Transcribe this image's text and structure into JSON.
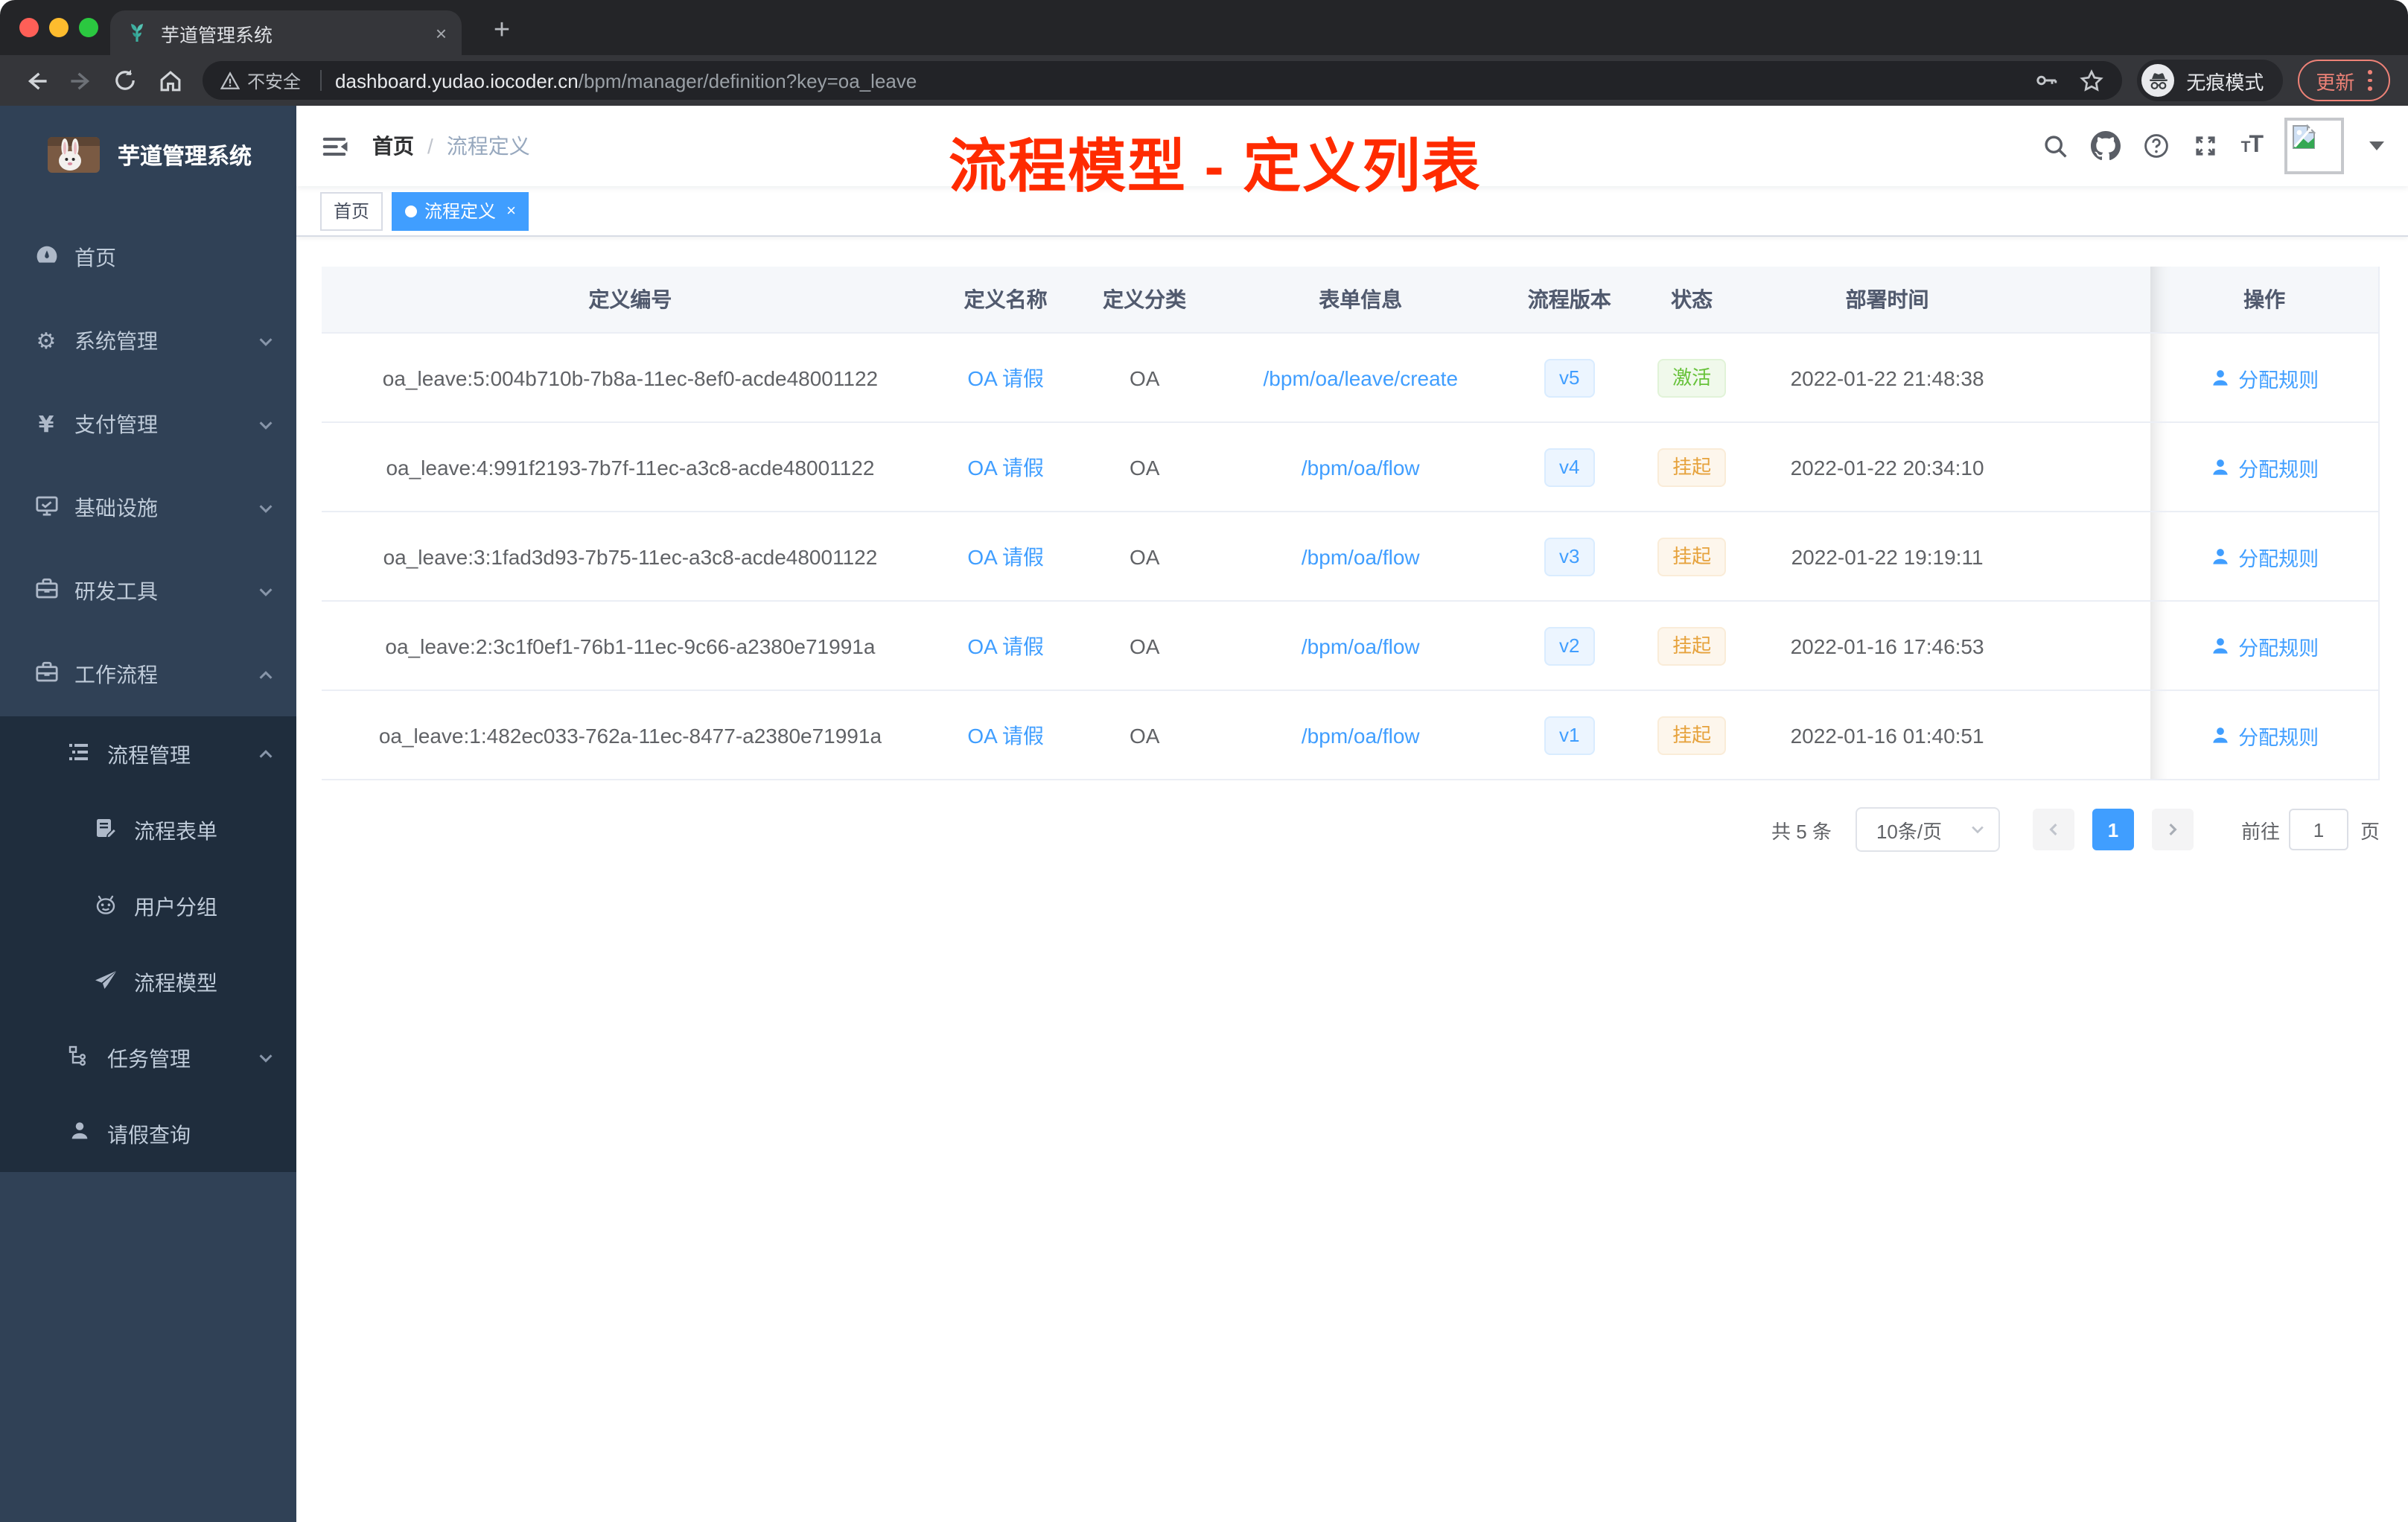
{
  "browser": {
    "tab_title": "芋道管理系统",
    "tab_close": "×",
    "new_tab": "+",
    "address": {
      "security_label": "不安全",
      "domain": "dashboard.yudao.iocoder.cn",
      "path": "/bpm/manager/definition?key=oa_leave"
    },
    "incognito_label": "无痕模式",
    "update_label": "更新"
  },
  "sidebar": {
    "logo_title": "芋道管理系统",
    "items": [
      {
        "label": "首页",
        "icon": "dashboard-icon"
      },
      {
        "label": "系统管理",
        "icon": "gear-icon"
      },
      {
        "label": "支付管理",
        "icon": "yen-icon"
      },
      {
        "label": "基础设施",
        "icon": "monitor-icon"
      },
      {
        "label": "研发工具",
        "icon": "toolbox-icon"
      },
      {
        "label": "工作流程",
        "icon": "briefcase-icon"
      }
    ],
    "submenu": [
      {
        "label": "流程管理",
        "icon": "list-tree-icon"
      },
      {
        "label": "流程表单",
        "icon": "form-edit-icon"
      },
      {
        "label": "用户分组",
        "icon": "robot-icon"
      },
      {
        "label": "流程模型",
        "icon": "paper-plane-icon"
      },
      {
        "label": "任务管理",
        "icon": "org-tree-icon"
      },
      {
        "label": "请假查询",
        "icon": "user-icon"
      }
    ]
  },
  "header": {
    "breadcrumb": {
      "home": "首页",
      "separator": "/",
      "current": "流程定义"
    },
    "annotation": "流程模型 - 定义列表"
  },
  "tags": {
    "inactive": "首页",
    "active": "流程定义",
    "close": "×"
  },
  "table": {
    "columns": [
      "定义编号",
      "定义名称",
      "定义分类",
      "表单信息",
      "流程版本",
      "状态",
      "部署时间",
      "操作"
    ],
    "rows": [
      {
        "id": "oa_leave:5:004b710b-7b8a-11ec-8ef0-acde48001122",
        "name": "OA 请假",
        "category": "OA",
        "form": "/bpm/oa/leave/create",
        "version": "v5",
        "status": "激活",
        "time": "2022-01-22 21:48:38",
        "action": "分配规则"
      },
      {
        "id": "oa_leave:4:991f2193-7b7f-11ec-a3c8-acde48001122",
        "name": "OA 请假",
        "category": "OA",
        "form": "/bpm/oa/flow",
        "version": "v4",
        "status": "挂起",
        "time": "2022-01-22 20:34:10",
        "action": "分配规则"
      },
      {
        "id": "oa_leave:3:1fad3d93-7b75-11ec-a3c8-acde48001122",
        "name": "OA 请假",
        "category": "OA",
        "form": "/bpm/oa/flow",
        "version": "v3",
        "status": "挂起",
        "time": "2022-01-22 19:19:11",
        "action": "分配规则"
      },
      {
        "id": "oa_leave:2:3c1f0ef1-76b1-11ec-9c66-a2380e71991a",
        "name": "OA 请假",
        "category": "OA",
        "form": "/bpm/oa/flow",
        "version": "v2",
        "status": "挂起",
        "time": "2022-01-16 17:46:53",
        "action": "分配规则"
      },
      {
        "id": "oa_leave:1:482ec033-762a-11ec-8477-a2380e71991a",
        "name": "OA 请假",
        "category": "OA",
        "form": "/bpm/oa/flow",
        "version": "v1",
        "status": "挂起",
        "time": "2022-01-16 01:40:51",
        "action": "分配规则"
      }
    ]
  },
  "pagination": {
    "total": "共 5 条",
    "page_size": "10条/页",
    "current_page": "1",
    "goto_label": "前往",
    "goto_value": "1",
    "page_unit": "页"
  },
  "colors": {
    "accent": "#409eff",
    "annotation_red": "#ff2b00",
    "status_active_green": "#67c23a",
    "status_suspended_orange": "#e6a23c",
    "sidebar_bg": "#304156",
    "submenu_bg": "#1f2d3d"
  }
}
